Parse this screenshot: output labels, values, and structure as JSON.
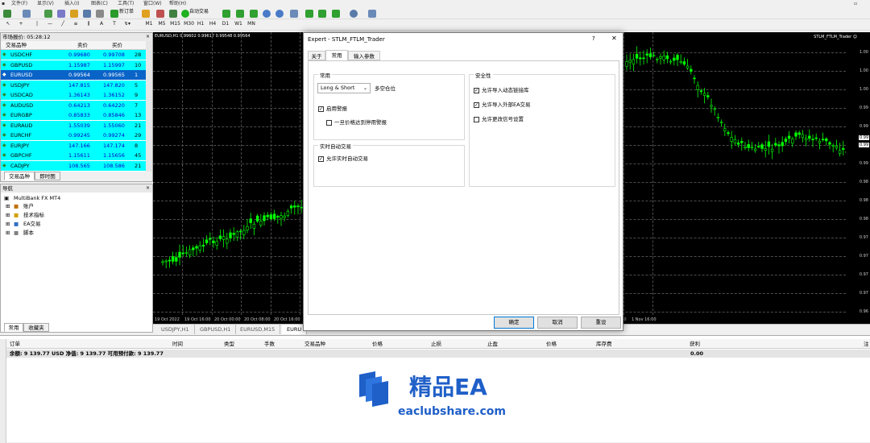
{
  "menu": [
    "文件(F)",
    "显示(V)",
    "插入(I)",
    "图表(C)",
    "工具(T)",
    "窗口(W)",
    "帮助(H)"
  ],
  "toolbar": {
    "new_order": "新订单",
    "auto_trading": "自动交易"
  },
  "timeframes": [
    "M1",
    "M5",
    "M15",
    "M30",
    "H1",
    "H4",
    "D1",
    "W1",
    "MN"
  ],
  "market_watch": {
    "title": "市场报价: 05:28:12",
    "col_symbol": "交易品种",
    "col_bid": "卖价",
    "col_ask": "买价",
    "rows": [
      {
        "symbol": "USDCHF",
        "bid": "0.99680",
        "ask": "0.99708",
        "spread": "28"
      },
      {
        "symbol": "GBPUSD",
        "bid": "1.15987",
        "ask": "1.15997",
        "spread": "10"
      },
      {
        "symbol": "EURUSD",
        "bid": "0.99564",
        "ask": "0.99565",
        "spread": "1"
      },
      {
        "symbol": "USDJPY",
        "bid": "147.815",
        "ask": "147.820",
        "spread": "5"
      },
      {
        "symbol": "USDCAD",
        "bid": "1.36143",
        "ask": "1.36152",
        "spread": "9"
      },
      {
        "symbol": "AUDUSD",
        "bid": "0.64213",
        "ask": "0.64220",
        "spread": "7"
      },
      {
        "symbol": "EURGBP",
        "bid": "0.85833",
        "ask": "0.85846",
        "spread": "13"
      },
      {
        "symbol": "EURAUD",
        "bid": "1.55039",
        "ask": "1.55060",
        "spread": "21"
      },
      {
        "symbol": "EURCHF",
        "bid": "0.99245",
        "ask": "0.99274",
        "spread": "29"
      },
      {
        "symbol": "EURJPY",
        "bid": "147.166",
        "ask": "147.174",
        "spread": "8"
      },
      {
        "symbol": "GBPCHF",
        "bid": "1.15611",
        "ask": "1.15656",
        "spread": "45"
      },
      {
        "symbol": "CADJPY",
        "bid": "108.565",
        "ask": "108.586",
        "spread": "21"
      }
    ],
    "tab_symbols": "交易品种",
    "tab_ticks": "即时图"
  },
  "navigator": {
    "title": "导航",
    "root": "MultiBank FX MT4",
    "items": [
      "账户",
      "技术指标",
      "EA交易",
      "脚本"
    ],
    "tab_common": "常用",
    "tab_fav": "收藏夹"
  },
  "chart": {
    "header": "EURUSD,H1  0.99602 0.99617 0.99548 0.99564",
    "ea_label": "STLM_FTLM_Trader ☺",
    "y_ticks": [
      "1.00",
      "1.00",
      "1.00",
      "0.99",
      "0.99",
      "0.99",
      "0.99",
      "0.98",
      "0.98",
      "0.98",
      "0.97",
      "0.97",
      "0.97",
      "0.97",
      "0.96"
    ],
    "price_tags": [
      "0.99",
      "0.99"
    ],
    "x_ticks": [
      "19 Oct 2022",
      "19 Oct 16:00",
      "20 Oct 00:00",
      "20 Oct 08:00",
      "20 Oct 16:00",
      "21 Oct 00:00",
      "27 Oct 08:00",
      "27 Oct 16:00",
      "28 Oct 00:00",
      "28 Oct 08:00",
      "28 Oct 16:00",
      "31 Oct 00:00",
      "31 Oct 08:00",
      "31 Oct 16:00",
      "1 Nov 00:00",
      "1 Nov 08:00",
      "1 Nov 16:00"
    ],
    "tabs": [
      "USDJPY,H1",
      "GBPUSD,H1",
      "EURUSD,M15",
      "EURU"
    ]
  },
  "dialog": {
    "title": "Expert - STLM_FTLM_Trader",
    "help": "?",
    "tabs": [
      "关于",
      "常用",
      "输入参数"
    ],
    "group_common": "常用",
    "position_select": "Long & Short",
    "position_label": "多空仓位",
    "enable_alerts": "启用警报",
    "disable_alerts_once": "一旦价格达到停用警报",
    "group_live": "实时自动交易",
    "allow_live": "允许实时自动交易",
    "group_safety": "安全性",
    "allow_dll": "允许导入动态链接库",
    "allow_ex_ea": "允许导入外部EA交易",
    "allow_signal": "允许更改信号设置",
    "ok": "确定",
    "cancel": "取消",
    "reset": "重设"
  },
  "terminal": {
    "columns": [
      "订单",
      "时间",
      "类型",
      "手数",
      "交易品种",
      "价格",
      "止损",
      "止盈",
      "价格",
      "库存费",
      "获利",
      "注"
    ],
    "balance_line": "余额: 9 139.77 USD  净值: 9 139.77  可用预付款: 9 139.77",
    "profit": "0.00"
  },
  "watermark": {
    "brand": "精品EA",
    "url": "eaclubshare.com"
  },
  "colors": {
    "candle": "#00ff00",
    "cyan_row": "#00ffff",
    "selected": "#0a64c8",
    "watermark": "#1f5fc8"
  }
}
